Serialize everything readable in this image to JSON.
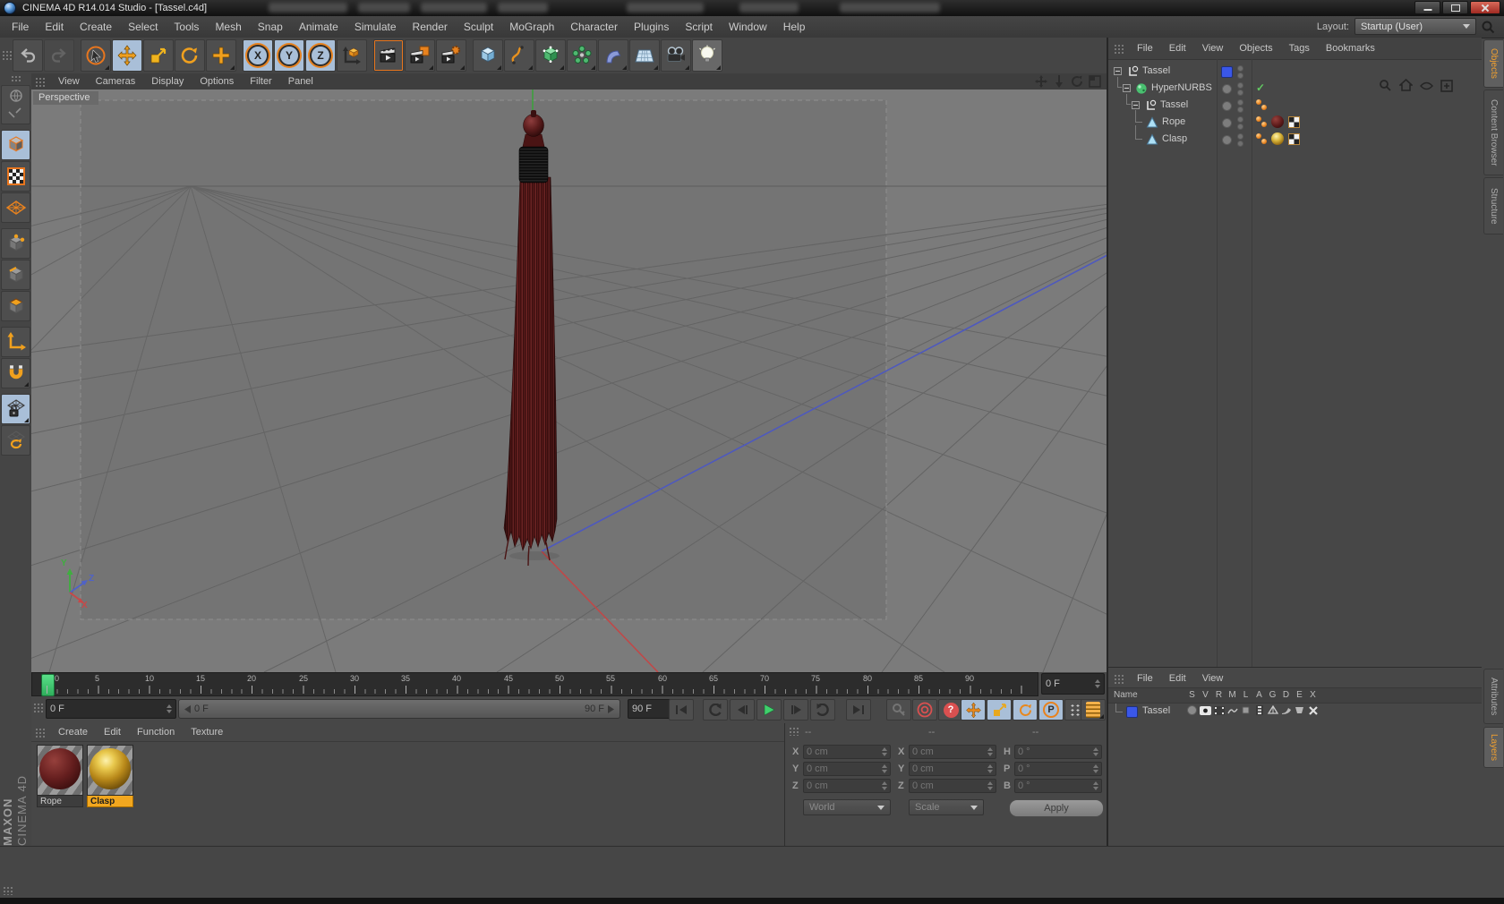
{
  "window": {
    "title": "CINEMA 4D R14.014 Studio - [Tassel.c4d]"
  },
  "menubar": {
    "items": [
      "File",
      "Edit",
      "Create",
      "Select",
      "Tools",
      "Mesh",
      "Snap",
      "Animate",
      "Simulate",
      "Render",
      "Sculpt",
      "MoGraph",
      "Character",
      "Plugins",
      "Script",
      "Window",
      "Help"
    ],
    "layout_label": "Layout:",
    "layout_value": "Startup (User)"
  },
  "toolbar": {
    "axis_labels": [
      "X",
      "Y",
      "Z"
    ]
  },
  "viewport": {
    "menu": [
      "View",
      "Cameras",
      "Display",
      "Options",
      "Filter",
      "Panel"
    ],
    "camera_label": "Perspective",
    "axis_gizmo": {
      "x": "X",
      "y": "Y",
      "z": "Z"
    }
  },
  "timeline": {
    "ticks": [
      "0",
      "5",
      "10",
      "15",
      "20",
      "25",
      "30",
      "35",
      "40",
      "45",
      "50",
      "55",
      "60",
      "65",
      "70",
      "75",
      "80",
      "85",
      "90"
    ],
    "current_frame": "0 F",
    "range_start": "0 F",
    "range_end": "90 F",
    "end_frame": "90 F"
  },
  "transport": {
    "p_label": "P",
    "help_label": "?"
  },
  "materials": {
    "menu": [
      "Create",
      "Edit",
      "Function",
      "Texture"
    ],
    "items": [
      {
        "name": "Rope",
        "selected": false
      },
      {
        "name": "Clasp",
        "selected": true
      }
    ]
  },
  "coordinates": {
    "headers": [
      "--",
      "--",
      "--"
    ],
    "rows": [
      {
        "l1": "X",
        "v1": "0 cm",
        "l2": "X",
        "v2": "0 cm",
        "l3": "H",
        "v3": "0 °"
      },
      {
        "l1": "Y",
        "v1": "0 cm",
        "l2": "Y",
        "v2": "0 cm",
        "l3": "P",
        "v3": "0 °"
      },
      {
        "l1": "Z",
        "v1": "0 cm",
        "l2": "Z",
        "v2": "0 cm",
        "l3": "B",
        "v3": "0 °"
      }
    ],
    "space": "World",
    "mode": "Scale",
    "apply_label": "Apply"
  },
  "object_manager": {
    "menu": [
      "File",
      "Edit",
      "View",
      "Objects",
      "Tags",
      "Bookmarks"
    ],
    "tree": [
      {
        "label": "Tassel"
      },
      {
        "label": "HyperNURBS"
      },
      {
        "label": "Tassel"
      },
      {
        "label": "Rope"
      },
      {
        "label": "Clasp"
      }
    ]
  },
  "layers_panel": {
    "menu": [
      "File",
      "Edit",
      "View"
    ],
    "name_header": "Name",
    "columns": [
      "S",
      "V",
      "R",
      "M",
      "L",
      "A",
      "G",
      "D",
      "E",
      "X"
    ],
    "rows": [
      {
        "name": "Tassel"
      }
    ]
  },
  "side_tabs": {
    "top": [
      "Objects",
      "Content Browser",
      "Structure"
    ],
    "bottom": [
      "Attributes",
      "Layers"
    ]
  },
  "branding": {
    "maxon": "MAXON",
    "product": "CINEMA 4D"
  },
  "colors": {
    "accent_orange": "#f29b34",
    "toggle_blue": "#a9bfd8",
    "record_red": "#d95050",
    "play_green": "#3fd06c",
    "check_green": "#62c862",
    "layer_blue": "#3a57e8",
    "material_red": "#6b2020",
    "material_gold": "#c9991c"
  },
  "icons": {
    "app": "cinema4d-logo",
    "search": "magnifier",
    "home": "house",
    "undo": "arrow-undo",
    "redo": "arrow-redo",
    "snap": "magnet",
    "light": "bulb",
    "camera": "movie-camera",
    "move": "cross-arrows",
    "scale": "square-arrow",
    "rotate": "arc-arrows"
  }
}
